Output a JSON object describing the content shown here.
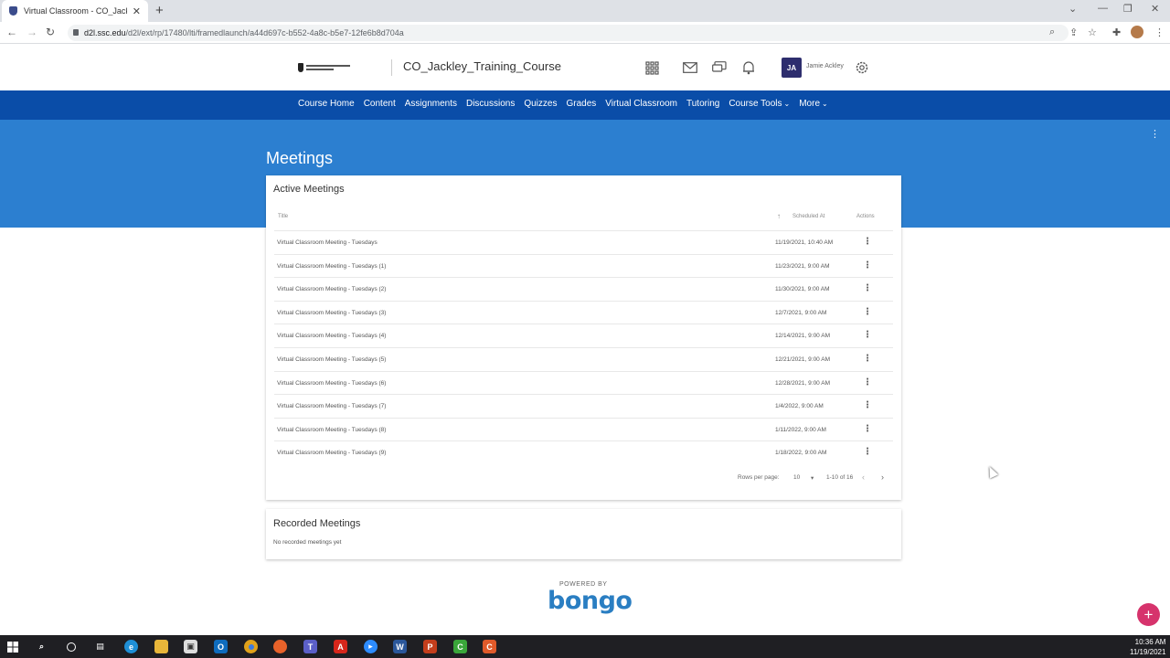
{
  "browser": {
    "tab_title": "Virtual Classroom - CO_Jackley_T",
    "url_host": "d2l.ssc.edu",
    "url_path": "/d2l/ext/rp/17480/lti/framedlaunch/a44d697c-b552-4a8c-b5e7-12fe6b8d704a"
  },
  "header": {
    "course_title": "CO_Jackley_Training_Course",
    "user_initials": "JA",
    "user_name": "Jamie Ackley"
  },
  "nav": {
    "items": [
      "Course Home",
      "Content",
      "Assignments",
      "Discussions",
      "Quizzes",
      "Grades",
      "Virtual Classroom",
      "Tutoring",
      "Course Tools",
      "More"
    ]
  },
  "page": {
    "title": "Meetings"
  },
  "active_meetings": {
    "title": "Active Meetings",
    "columns": {
      "title": "Title",
      "scheduled": "Scheduled At",
      "actions": "Actions"
    },
    "rows": [
      {
        "title": "Virtual Classroom Meeting - Tuesdays",
        "scheduled": "11/19/2021, 10:40 AM"
      },
      {
        "title": "Virtual Classroom Meeting - Tuesdays (1)",
        "scheduled": "11/23/2021, 9:00 AM"
      },
      {
        "title": "Virtual Classroom Meeting - Tuesdays (2)",
        "scheduled": "11/30/2021, 9:00 AM"
      },
      {
        "title": "Virtual Classroom Meeting - Tuesdays (3)",
        "scheduled": "12/7/2021, 9:00 AM"
      },
      {
        "title": "Virtual Classroom Meeting - Tuesdays (4)",
        "scheduled": "12/14/2021, 9:00 AM"
      },
      {
        "title": "Virtual Classroom Meeting - Tuesdays (5)",
        "scheduled": "12/21/2021, 9:00 AM"
      },
      {
        "title": "Virtual Classroom Meeting - Tuesdays (6)",
        "scheduled": "12/28/2021, 9:00 AM"
      },
      {
        "title": "Virtual Classroom Meeting - Tuesdays (7)",
        "scheduled": "1/4/2022, 9:00 AM"
      },
      {
        "title": "Virtual Classroom Meeting - Tuesdays (8)",
        "scheduled": "1/11/2022, 9:00 AM"
      },
      {
        "title": "Virtual Classroom Meeting - Tuesdays (9)",
        "scheduled": "1/18/2022, 9:00 AM"
      }
    ],
    "pagination": {
      "rows_label": "Rows per page:",
      "rows_value": "10",
      "range": "1-10 of 16"
    }
  },
  "recorded_meetings": {
    "title": "Recorded Meetings",
    "empty_text": "No recorded meetings yet"
  },
  "footer": {
    "powered_by": "POWERED BY",
    "brand": "bongo"
  },
  "taskbar": {
    "time": "10:36 AM",
    "date": "11/19/2021"
  },
  "colors": {
    "nav": "#0a4da8",
    "band": "#2c7fd0",
    "fab": "#d6336c",
    "bongo": "#2a7ec2"
  }
}
